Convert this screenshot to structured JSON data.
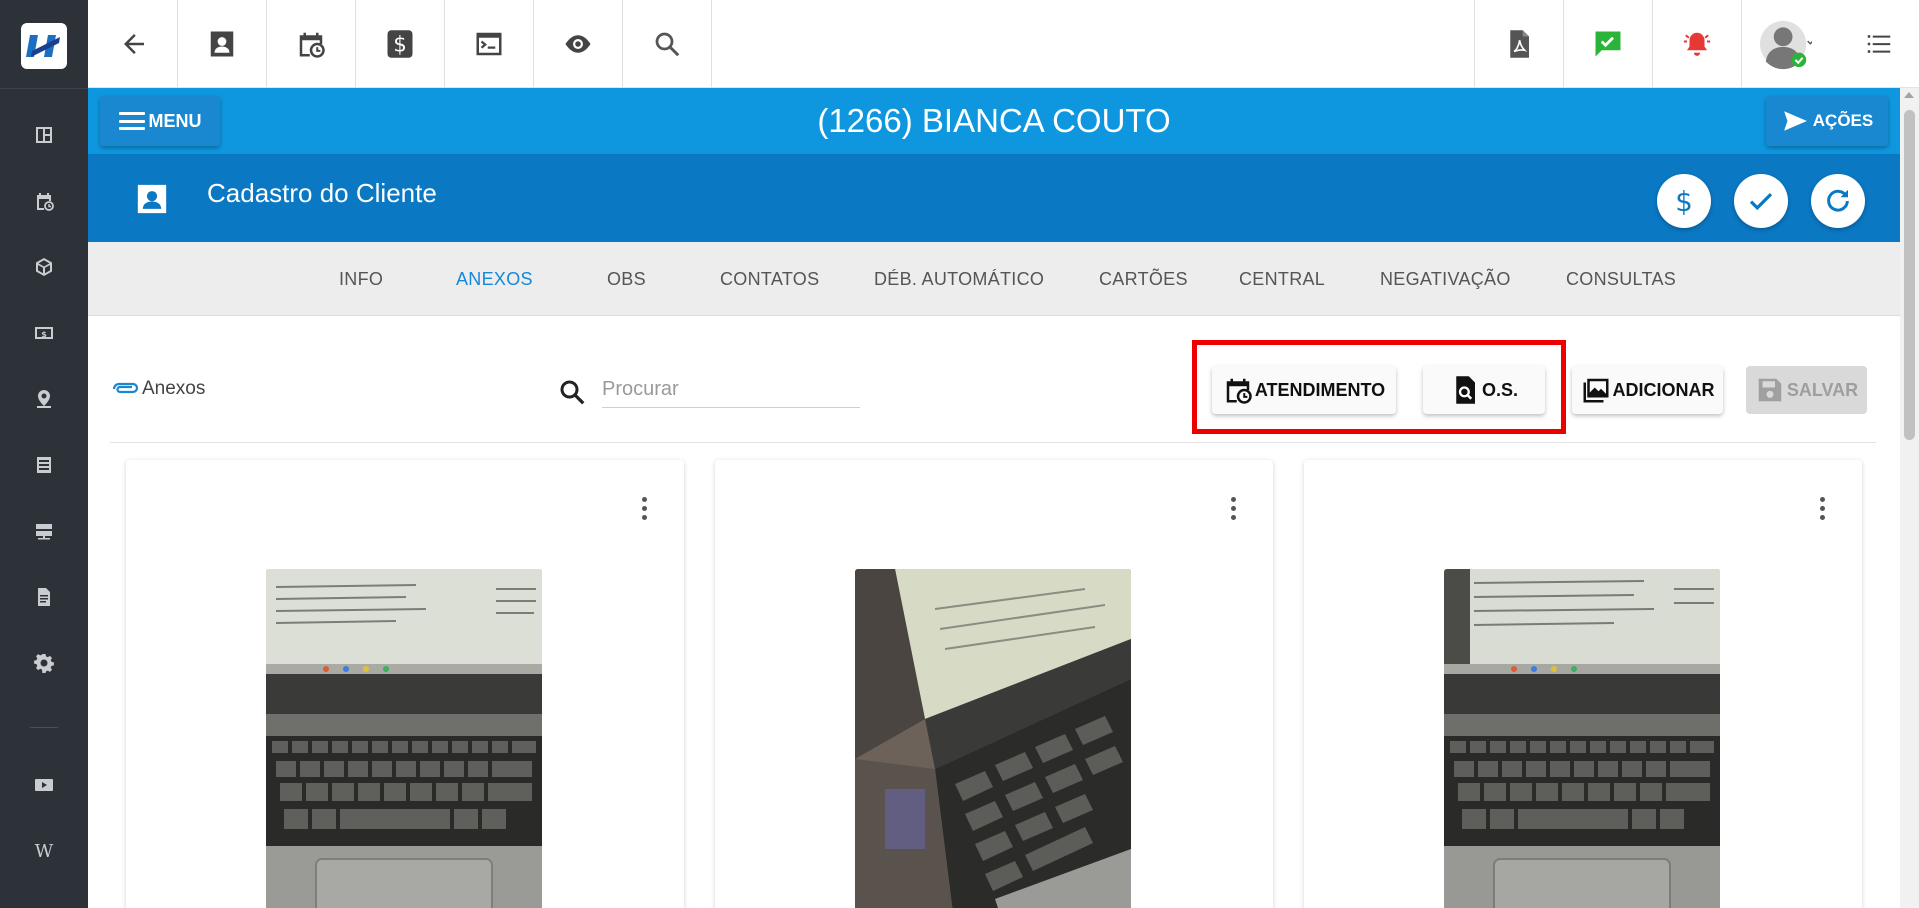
{
  "app": {
    "title": "(1266) BIANCA COUTO",
    "menu_label": "MENU",
    "acoes_label": "AÇÕES"
  },
  "section": {
    "title": "Cadastro do Cliente"
  },
  "tabs": [
    {
      "label": "INFO",
      "active": false
    },
    {
      "label": "ANEXOS",
      "active": true
    },
    {
      "label": "OBS",
      "active": false
    },
    {
      "label": "CONTATOS",
      "active": false
    },
    {
      "label": "DÉB. AUTOMÁTICO",
      "active": false
    },
    {
      "label": "CARTÕES",
      "active": false
    },
    {
      "label": "CENTRAL",
      "active": false
    },
    {
      "label": "NEGATIVAÇÃO",
      "active": false
    },
    {
      "label": "CONSULTAS",
      "active": false
    }
  ],
  "anexos": {
    "label": "Anexos",
    "search_placeholder": "Procurar",
    "buttons": {
      "atendimento": "ATENDIMENTO",
      "os": "O.S.",
      "adicionar": "ADICIONAR",
      "salvar": "SALVAR"
    },
    "cards": [
      {
        "photo": "laptop-photo"
      },
      {
        "photo": "laptop-photo"
      },
      {
        "photo": "laptop-photo"
      }
    ]
  },
  "colors": {
    "sidebar": "#2d3238",
    "title_bar": "#0e97de",
    "section_header": "#0b78c4",
    "active_tab": "#1688d8",
    "highlight": "#ee0000",
    "whatsapp_green": "#2bb33a",
    "alert_red": "#e53935"
  },
  "icons": {
    "sidebar": [
      "dashboard-icon",
      "calendar-clock-icon",
      "cube-icon",
      "money-icon",
      "map-pin-icon",
      "list-icon",
      "server-icon",
      "document-icon",
      "gear-icon",
      "youtube-icon",
      "wiki-icon"
    ],
    "toolbar": [
      "back-arrow-icon",
      "contact-card-icon",
      "calendar-clock-icon",
      "dollar-icon",
      "terminal-icon",
      "eye-icon",
      "search-icon",
      "pdf-icon",
      "chat-check-icon",
      "alarm-bell-icon",
      "user-avatar-icon",
      "list-menu-icon"
    ]
  }
}
